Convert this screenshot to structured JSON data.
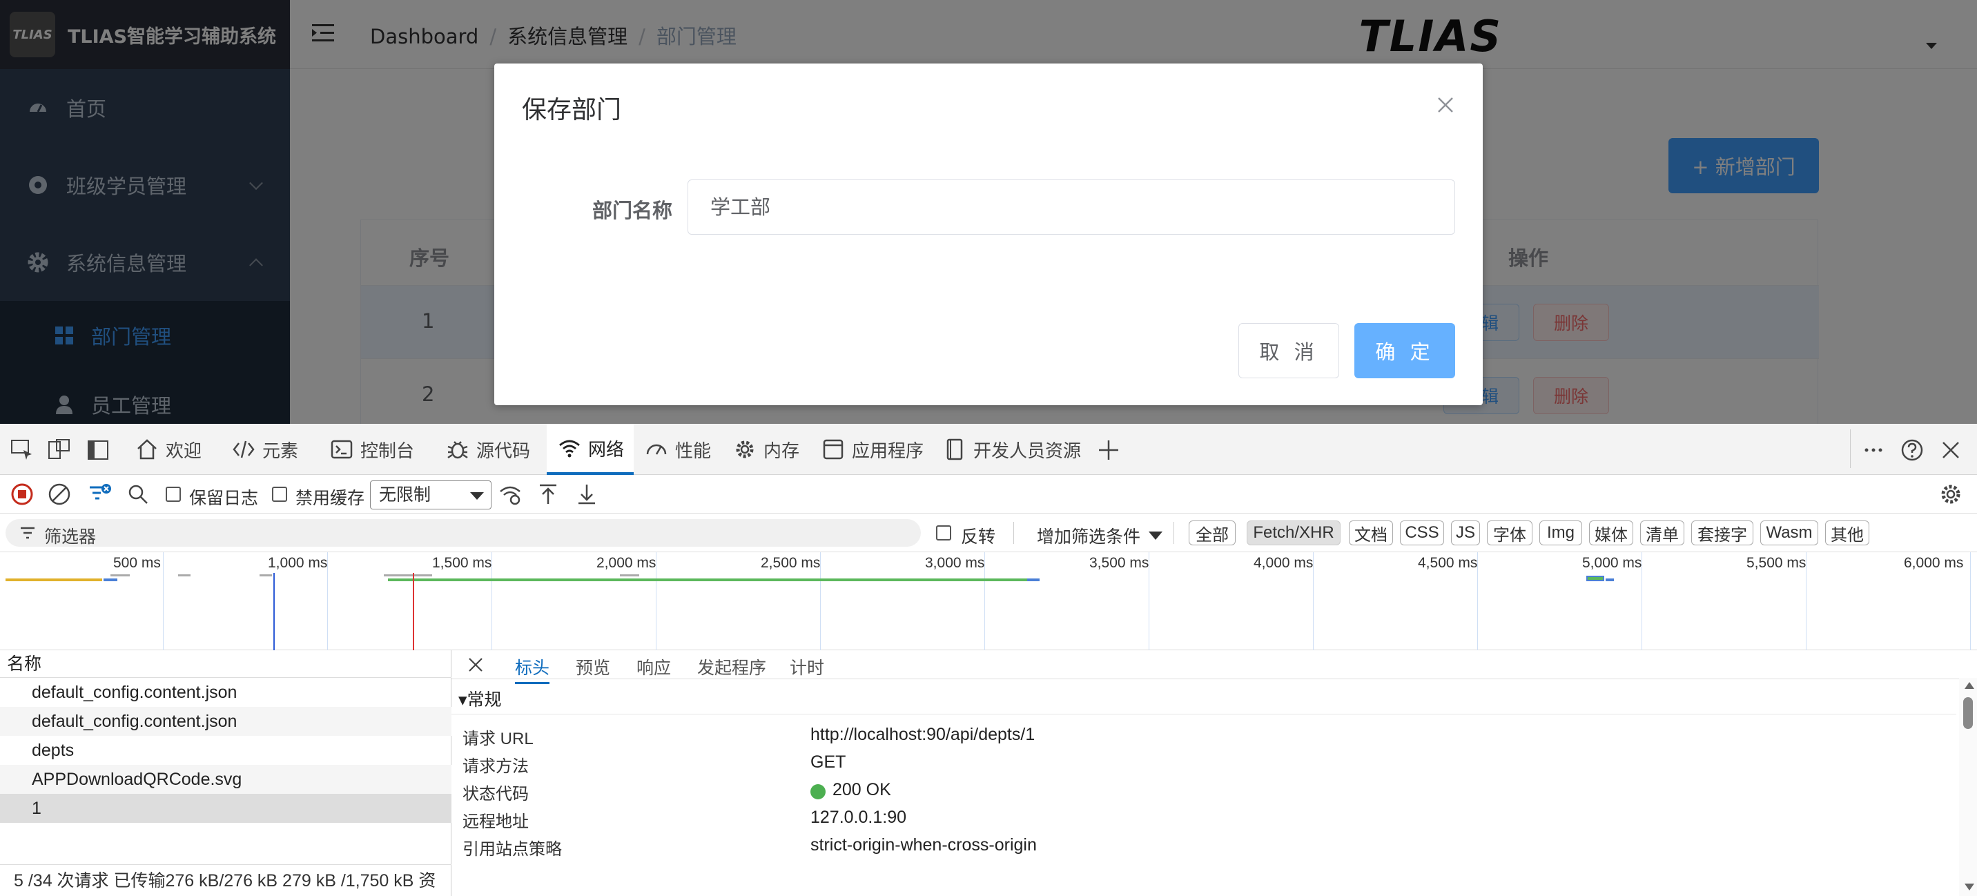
{
  "app": {
    "logo_text": "TLIAS",
    "title": "TLIAS智能学习辅助系统",
    "brand_text": "TLIAS",
    "sidebar": {
      "items": [
        {
          "label": "首页"
        },
        {
          "label": "班级学员管理"
        },
        {
          "label": "系统信息管理"
        }
      ],
      "sub_items": [
        {
          "label": "部门管理",
          "active": true
        },
        {
          "label": "员工管理"
        }
      ]
    },
    "breadcrumb": [
      "Dashboard",
      "系统信息管理",
      "部门管理"
    ],
    "add_button": "+ 新增部门",
    "table": {
      "headers": [
        "序号",
        "操作"
      ],
      "rows": [
        {
          "index": "1",
          "edit": "编辑",
          "delete": "删除"
        },
        {
          "index": "2",
          "edit": "编辑",
          "delete": "删除"
        }
      ]
    },
    "dialog": {
      "title": "保存部门",
      "field_label": "部门名称",
      "field_value": "学工部",
      "cancel": "取 消",
      "confirm": "确 定"
    }
  },
  "devtools": {
    "tabs": [
      {
        "label": "欢迎",
        "icon": "home-icon"
      },
      {
        "label": "元素",
        "icon": "code-icon"
      },
      {
        "label": "控制台",
        "icon": "console-icon"
      },
      {
        "label": "源代码",
        "icon": "bug-icon"
      },
      {
        "label": "网络",
        "icon": "wifi-icon",
        "active": true
      },
      {
        "label": "性能",
        "icon": "gauge-icon"
      },
      {
        "label": "内存",
        "icon": "gear-icon"
      },
      {
        "label": "应用程序",
        "icon": "window-icon"
      },
      {
        "label": "开发人员资源",
        "icon": "book-icon"
      }
    ],
    "toolbar": {
      "preserve_log": "保留日志",
      "disable_cache": "禁用缓存",
      "throttle": "无限制"
    },
    "filter": {
      "placeholder": "筛选器",
      "invert": "反转",
      "more_filters": "增加筛选条件",
      "chips": [
        "全部",
        "Fetch/XHR",
        "文档",
        "CSS",
        "JS",
        "字体",
        "Img",
        "媒体",
        "清单",
        "套接字",
        "Wasm",
        "其他"
      ],
      "active_chip": "Fetch/XHR"
    },
    "timeline_ticks": [
      "500 ms",
      "1,000 ms",
      "1,500 ms",
      "2,000 ms",
      "2,500 ms",
      "3,000 ms",
      "3,500 ms",
      "4,000 ms",
      "4,500 ms",
      "5,000 ms",
      "5,500 ms",
      "6,000 ms"
    ],
    "requests": {
      "header": "名称",
      "items": [
        "default_config.content.json",
        "default_config.content.json",
        "depts",
        "APPDownloadQRCode.svg",
        "1"
      ],
      "selected_index": 4
    },
    "status": "5 /34 次请求   已传输276 kB/276 kB   279 kB /1,750 kB 资",
    "detail": {
      "tabs": [
        "标头",
        "预览",
        "响应",
        "发起程序",
        "计时"
      ],
      "active_tab": "标头",
      "section": "▾常规",
      "rows": [
        {
          "key": "请求 URL",
          "value": "http://localhost:90/api/depts/1"
        },
        {
          "key": "请求方法",
          "value": "GET"
        },
        {
          "key": "状态代码",
          "value": "200 OK"
        },
        {
          "key": "远程地址",
          "value": "127.0.0.1:90"
        },
        {
          "key": "引用站点策略",
          "value": "strict-origin-when-cross-origin"
        }
      ],
      "status_color": "#4caf50"
    }
  }
}
